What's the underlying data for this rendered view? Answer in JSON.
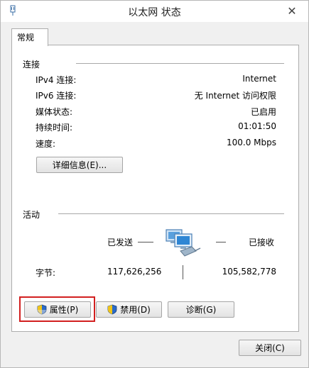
{
  "window": {
    "title": "以太网 状态",
    "close_glyph": "✕"
  },
  "tabs": [
    {
      "label": "常规"
    }
  ],
  "connection": {
    "header": "连接",
    "rows": [
      {
        "label": "IPv4 连接:",
        "value": "Internet"
      },
      {
        "label": "IPv6 连接:",
        "value": "无 Internet 访问权限"
      },
      {
        "label": "媒体状态:",
        "value": "已启用"
      },
      {
        "label": "持续时间:",
        "value": "01:01:50"
      },
      {
        "label": "速度:",
        "value": "100.0 Mbps"
      }
    ],
    "details_button": "详细信息(E)..."
  },
  "activity": {
    "header": "活动",
    "sent_label": "已发送",
    "received_label": "已接收",
    "bytes_label": "字节:",
    "bytes_sent": "117,626,256",
    "bytes_received": "105,582,778"
  },
  "buttons": {
    "properties": "属性(P)",
    "disable": "禁用(D)",
    "diagnose": "诊断(G)",
    "close": "关闭(C)"
  },
  "colors": {
    "highlight_border": "#d21f1f"
  }
}
